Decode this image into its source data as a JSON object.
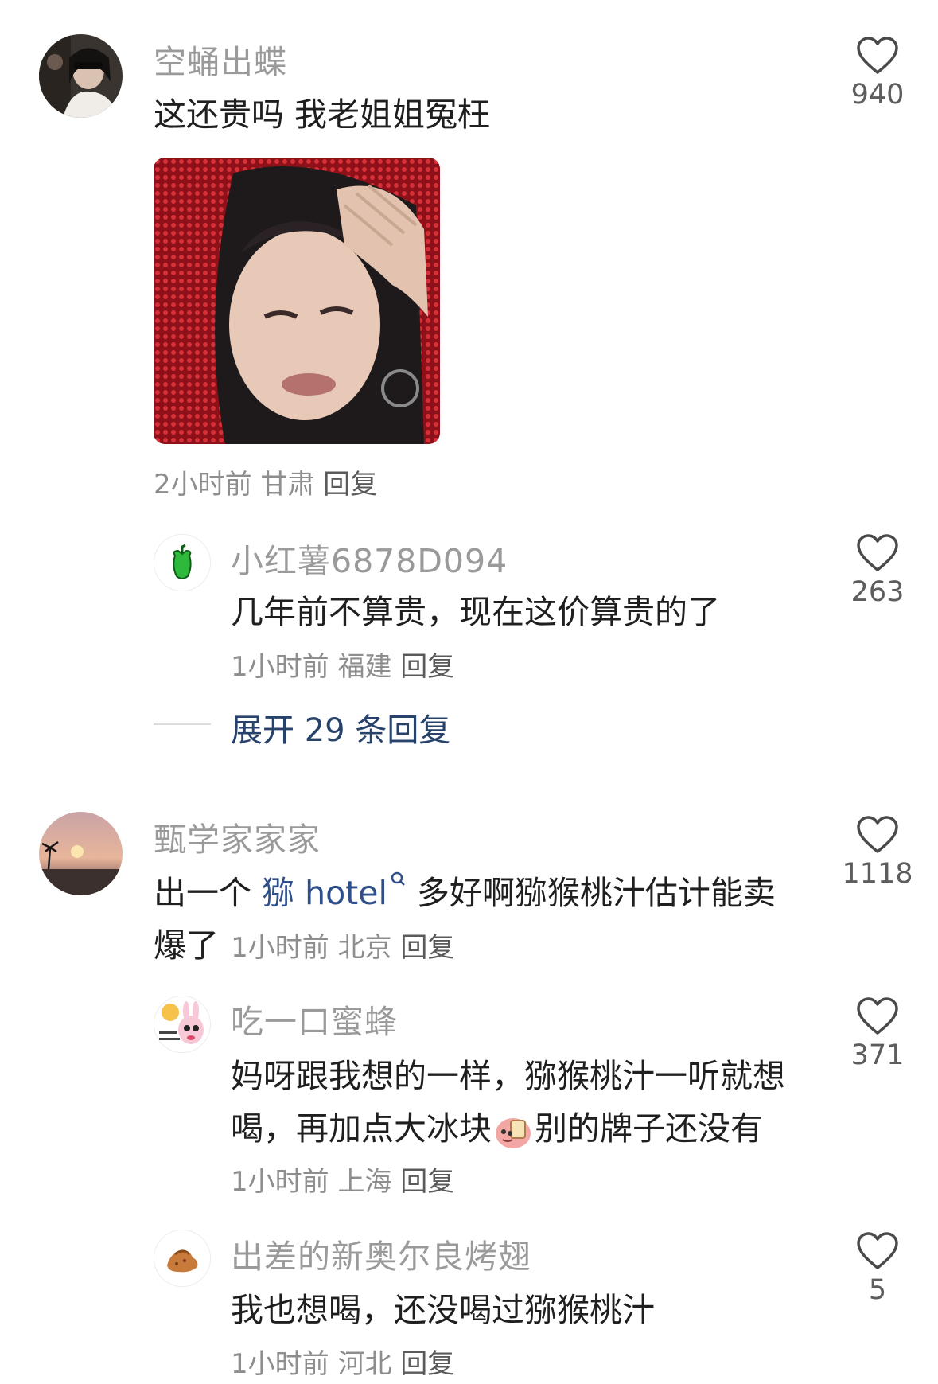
{
  "comments": [
    {
      "username": "空蛹出蝶",
      "text": "这还贵吗 我老姐姐冤枉",
      "meta_time": "2小时前",
      "meta_location": "甘肃",
      "reply_label": "回复",
      "likes": "940",
      "replies": [
        {
          "username": "小红薯6878D094",
          "text": "几年前不算贵，现在这价算贵的了",
          "meta_time": "1小时前",
          "meta_location": "福建",
          "reply_label": "回复",
          "likes": "263"
        }
      ],
      "expand_label": "展开 29 条回复"
    },
    {
      "username": "甄学家家家",
      "text_prefix": "出一个 ",
      "mention": "猕 hotel",
      "text_rest": " 多好啊猕猴桃汁估计能卖",
      "text_line2": "爆了",
      "meta_time": "1小时前",
      "meta_location": "北京",
      "reply_label": "回复",
      "likes": "1118",
      "replies": [
        {
          "username": "吃一口蜜蜂",
          "text_line1": "妈呀跟我想的一样，猕猴桃汁一听就想",
          "text_line2_a": "喝，再加点大冰块",
          "text_line2_b": "别的牌子还没有",
          "meta_time": "1小时前",
          "meta_location": "上海",
          "reply_label": "回复",
          "likes": "371"
        },
        {
          "username": "出差的新奥尔良烤翅",
          "text": "我也想喝，还没喝过猕猴桃汁",
          "meta_time": "1小时前",
          "meta_location": "河北",
          "reply_label": "回复",
          "likes": "5"
        }
      ]
    }
  ],
  "icons": {
    "heart": "heart-outline-icon",
    "search": "search-icon"
  },
  "colors": {
    "username": "#9a9a9a",
    "link": "#27426b",
    "text": "#1f1f1f"
  }
}
